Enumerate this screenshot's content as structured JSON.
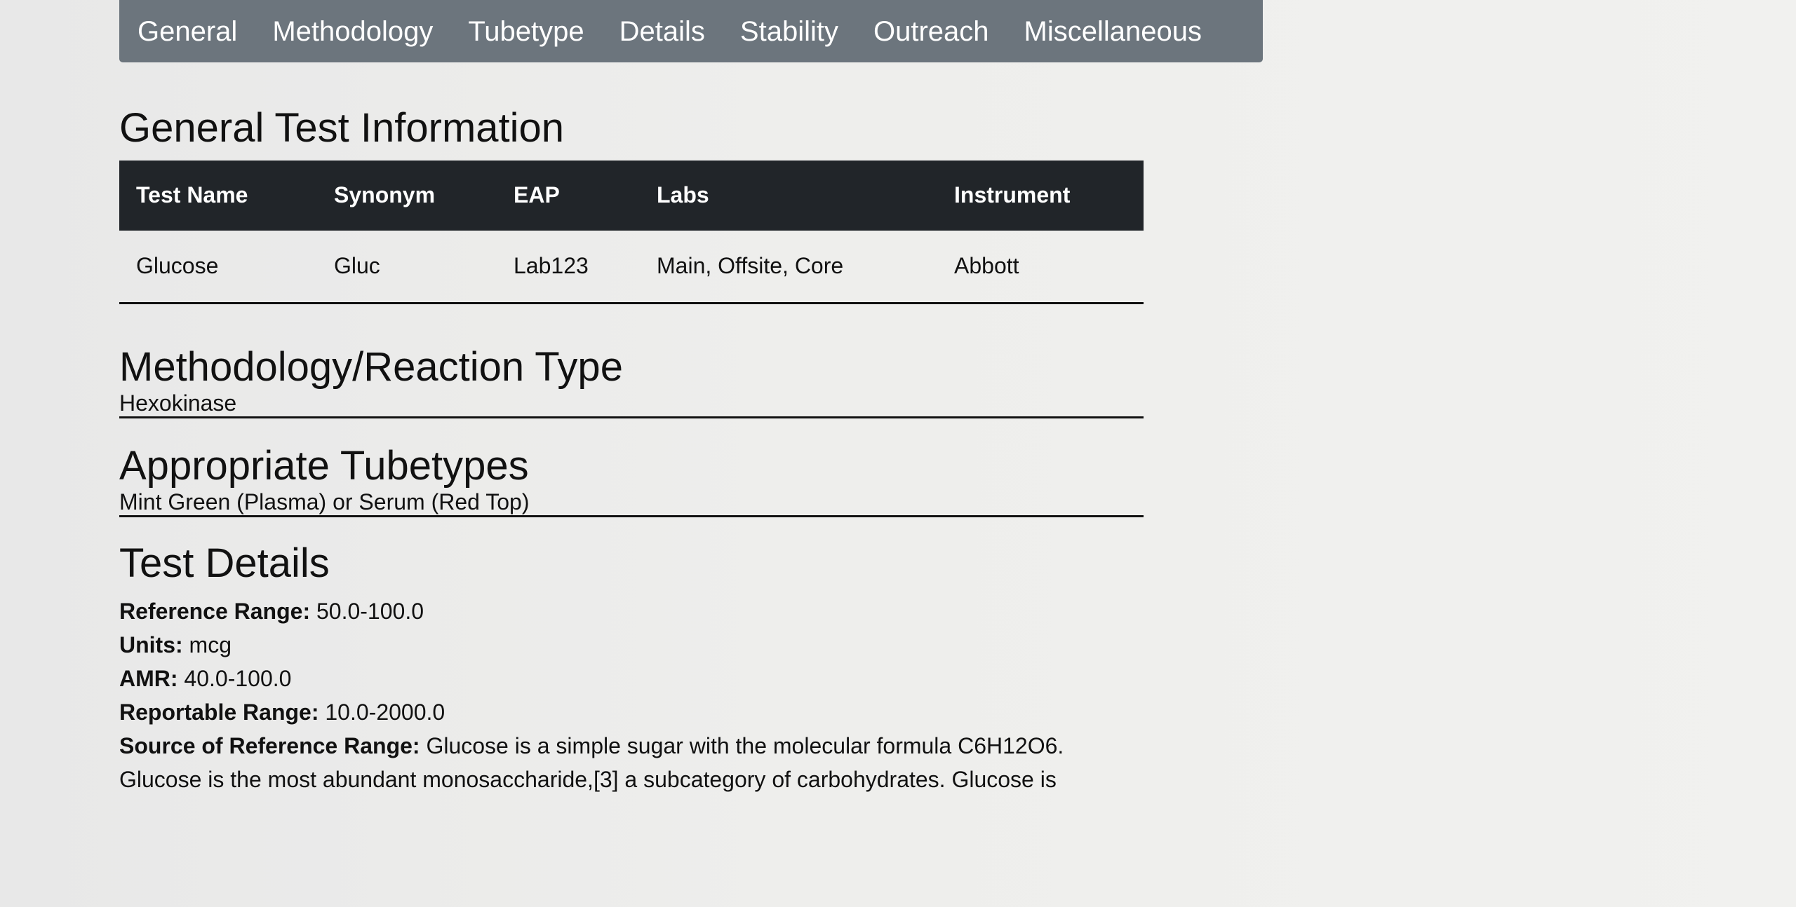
{
  "nav": {
    "items": [
      "General",
      "Methodology",
      "Tubetype",
      "Details",
      "Stability",
      "Outreach",
      "Miscellaneous"
    ]
  },
  "general": {
    "title": "General Test Information",
    "table": {
      "headers": [
        "Test Name",
        "Synonym",
        "EAP",
        "Labs",
        "Instrument"
      ],
      "rows": [
        [
          "Glucose",
          "Gluc",
          "Lab123",
          "Main, Offsite, Core",
          "Abbott"
        ]
      ]
    }
  },
  "methodology": {
    "title": "Methodology/Reaction Type",
    "value": "Hexokinase"
  },
  "tubetypes": {
    "title": "Appropriate Tubetypes",
    "value": "Mint Green (Plasma) or Serum (Red Top)"
  },
  "details": {
    "title": "Test Details",
    "reference_range": {
      "label": "Reference Range:",
      "value": "50.0-100.0"
    },
    "units": {
      "label": "Units:",
      "value": "mcg"
    },
    "amr": {
      "label": "AMR:",
      "value": "40.0-100.0"
    },
    "reportable_range": {
      "label": "Reportable Range:",
      "value": "10.0-2000.0"
    },
    "source": {
      "label": "Source of Reference Range:",
      "value": "Glucose is a simple sugar with the molecular formula C6H12O6."
    },
    "source_continued": "Glucose is the most abundant monosaccharide,[3] a subcategory of carbohydrates. Glucose is"
  }
}
